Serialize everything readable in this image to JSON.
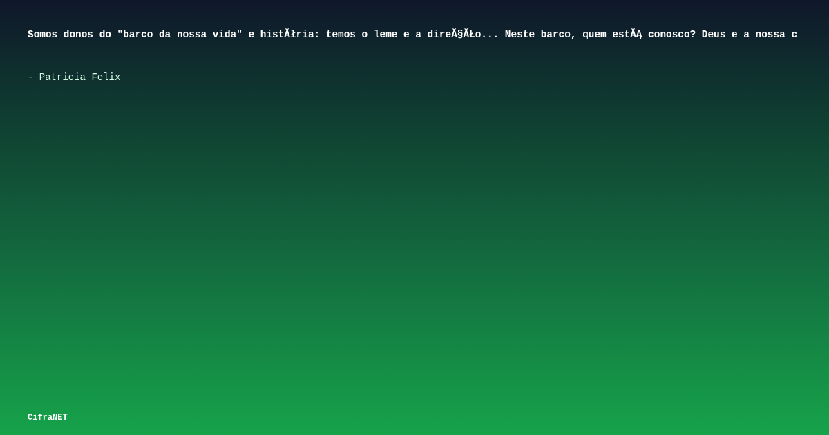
{
  "quote": "Somos donos do \"barco da nossa vida\" e histĂłria: temos o leme e a direĂ§ĂŁo... Neste barco, quem estĂĄ conosco? Deus e a nossa c",
  "author": "- Patricia Felix",
  "brand": "CifraNET"
}
